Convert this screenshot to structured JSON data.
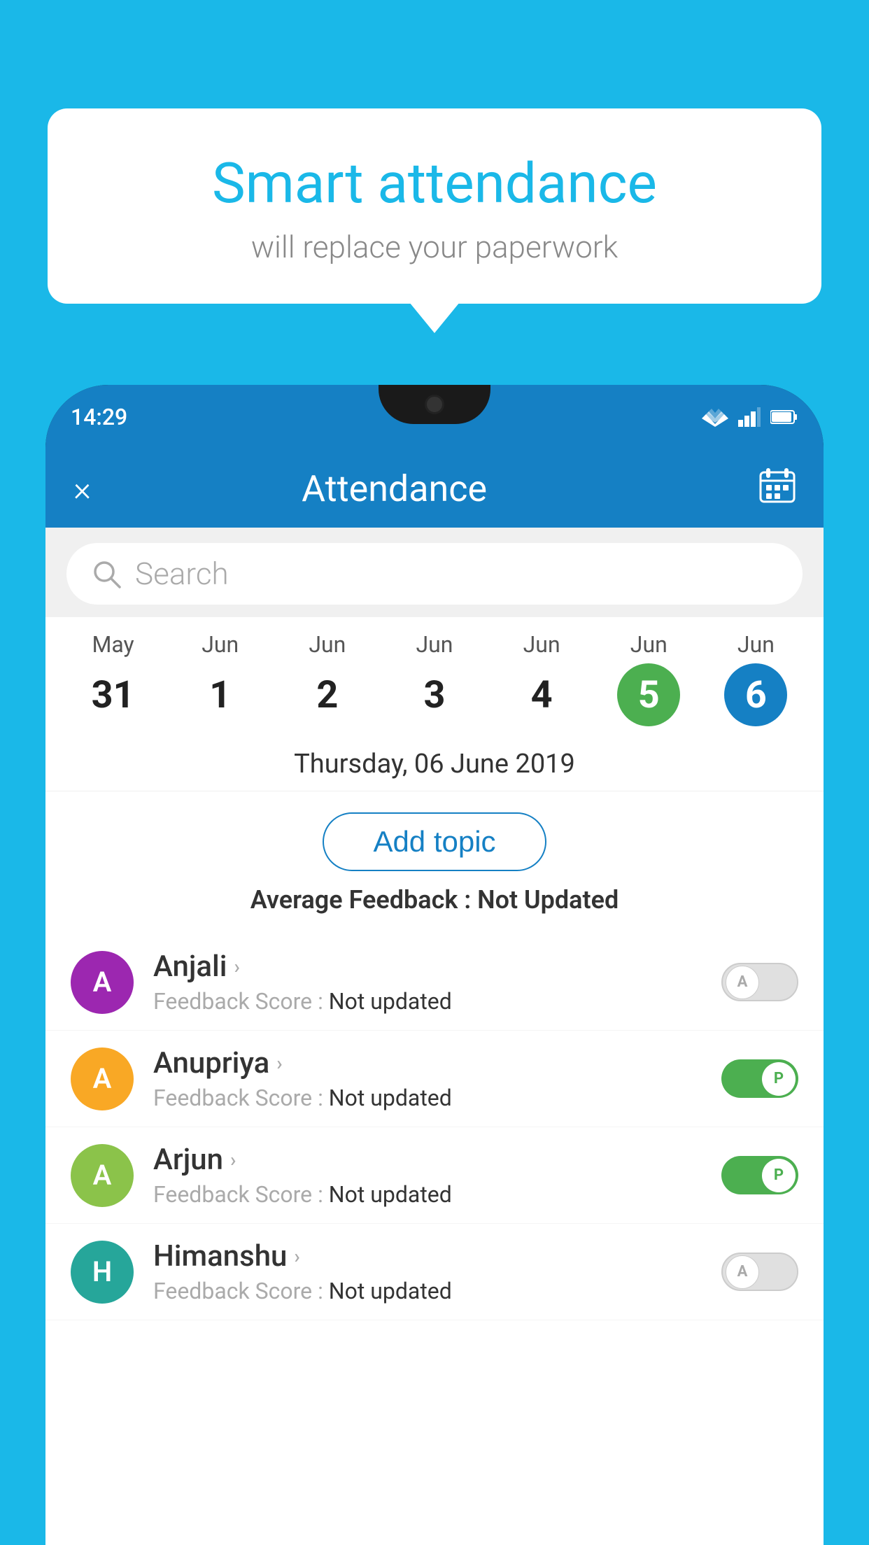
{
  "background_color": "#1ab8e8",
  "speech_bubble": {
    "title": "Smart attendance",
    "subtitle": "will replace your paperwork"
  },
  "status_bar": {
    "time": "14:29"
  },
  "app_bar": {
    "title": "Attendance",
    "close_label": "×"
  },
  "search": {
    "placeholder": "Search"
  },
  "date_strip": {
    "dates": [
      {
        "month": "May",
        "day": "31",
        "state": "normal"
      },
      {
        "month": "Jun",
        "day": "1",
        "state": "normal"
      },
      {
        "month": "Jun",
        "day": "2",
        "state": "normal"
      },
      {
        "month": "Jun",
        "day": "3",
        "state": "normal"
      },
      {
        "month": "Jun",
        "day": "4",
        "state": "normal"
      },
      {
        "month": "Jun",
        "day": "5",
        "state": "today"
      },
      {
        "month": "Jun",
        "day": "6",
        "state": "selected"
      }
    ]
  },
  "selected_date_label": "Thursday, 06 June 2019",
  "add_topic_button": "Add topic",
  "average_feedback": {
    "label": "Average Feedback : ",
    "value": "Not Updated"
  },
  "students": [
    {
      "name": "Anjali",
      "avatar_letter": "A",
      "avatar_color": "purple",
      "feedback_label": "Feedback Score : ",
      "feedback_value": "Not updated",
      "toggle_state": "off",
      "toggle_label": "A"
    },
    {
      "name": "Anupriya",
      "avatar_letter": "A",
      "avatar_color": "yellow",
      "feedback_label": "Feedback Score : ",
      "feedback_value": "Not updated",
      "toggle_state": "on",
      "toggle_label": "P"
    },
    {
      "name": "Arjun",
      "avatar_letter": "A",
      "avatar_color": "green-light",
      "feedback_label": "Feedback Score : ",
      "feedback_value": "Not updated",
      "toggle_state": "on",
      "toggle_label": "P"
    },
    {
      "name": "Himanshu",
      "avatar_letter": "H",
      "avatar_color": "teal",
      "feedback_label": "Feedback Score : ",
      "feedback_value": "Not updated",
      "toggle_state": "off",
      "toggle_label": "A"
    }
  ]
}
